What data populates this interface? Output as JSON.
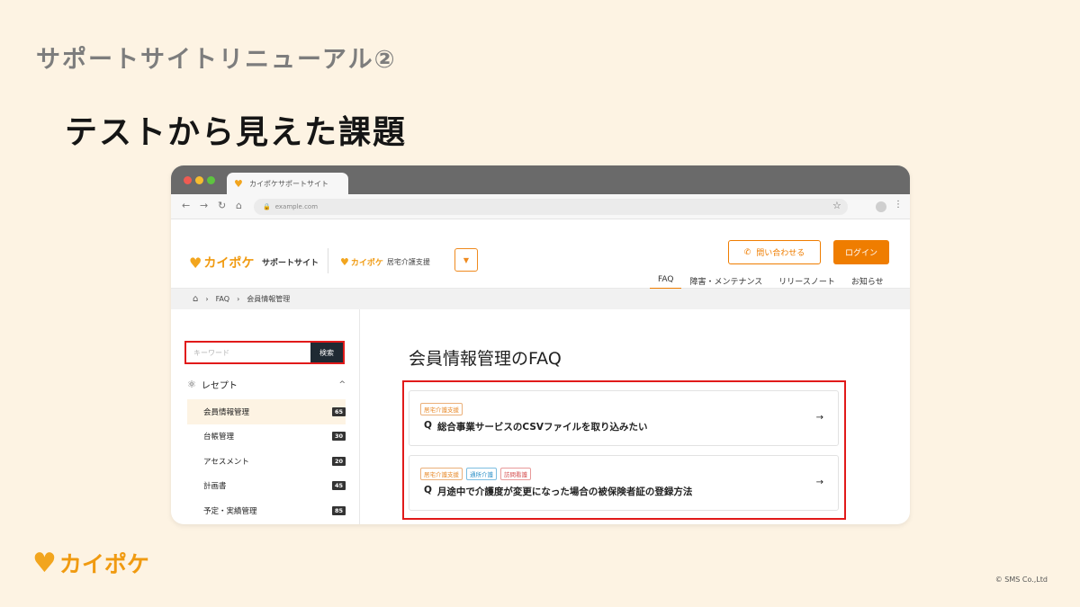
{
  "slide": {
    "subtitle": "サポートサイトリニューアル②",
    "title": "テストから見えた課題",
    "copyright": "© SMS Co.,Ltd",
    "footer_logo": "カイポケ"
  },
  "browser": {
    "tab_title": "カイポケサポートサイト",
    "url": "example.com"
  },
  "site": {
    "logo": "カイポケ",
    "support_label": "サポートサイト",
    "sub_logo": "カイポケ",
    "sub_logo_desc": "居宅介護支援",
    "contact_label": "問い合わせる",
    "login_label": "ログイン",
    "nav": [
      "FAQ",
      "障害・メンテナンス",
      "リリースノート",
      "お知らせ"
    ]
  },
  "breadcrumb": [
    "FAQ",
    "会員情報管理"
  ],
  "sidebar": {
    "search_placeholder": "キーワード",
    "search_button": "検索",
    "category": "レセプト",
    "items": [
      {
        "label": "会員情報管理",
        "count": "65"
      },
      {
        "label": "台帳管理",
        "count": "30"
      },
      {
        "label": "アセスメント",
        "count": "20"
      },
      {
        "label": "計画書",
        "count": "45"
      },
      {
        "label": "予定・実績管理",
        "count": "85"
      }
    ]
  },
  "content": {
    "title": "会員情報管理のFAQ",
    "faqs": [
      {
        "tags": [
          "居宅介護支援"
        ],
        "q": "Q",
        "text": "総合事業サービスのCSVファイルを取り込みたい"
      },
      {
        "tags": [
          "居宅介護支援",
          "通所介護",
          "訪問看護"
        ],
        "q": "Q",
        "text": "月途中で介護度が変更になった場合の被保険者証の登録方法"
      }
    ]
  },
  "colors": {
    "accent": "#ef7d00",
    "highlight": "#e11a1a",
    "background": "#fdf3e3"
  }
}
